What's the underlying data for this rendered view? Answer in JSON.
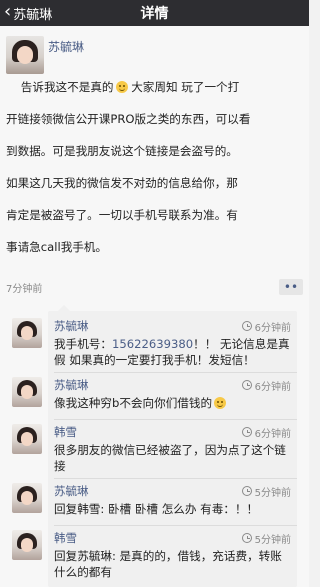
{
  "nav": {
    "back_label": "苏毓琳",
    "title": "详情"
  },
  "post": {
    "author": "苏毓琳",
    "text_lines": [
      "告诉我这不是真的",
      " 大家周知 玩了一个打",
      "开链接领微信公开课PRO版之类的东西，可以看",
      "到数据。可是我朋友说这个链接是会盗号的。",
      "如果这几天我的微信发不对劲的信息给你，那",
      "肯定是被盗号了。一切以手机号联系为准。有",
      "事请急call我手机。"
    ],
    "time": "7分钟前"
  },
  "comments": [
    {
      "name": "苏毓琳",
      "time": "6分钟前",
      "text_prefix": "我手机号：",
      "phone": "15622639380",
      "text_suffix": "！！ 无论信息是真假 如果真的一定要打我手机！发短信！"
    },
    {
      "name": "苏毓琳",
      "time": "6分钟前",
      "text": "像我这种穷b不会向你们借钱的"
    },
    {
      "name": "韩雪",
      "time": "6分钟前",
      "text": "很多朋友的微信已经被盗了，因为点了这个链接"
    },
    {
      "name": "苏毓琳",
      "time": "5分钟前",
      "text": "回复韩雪: 卧槽 卧槽 怎么办 有毒：！！"
    },
    {
      "name": "韩雪",
      "time": "5分钟前",
      "text": "回复苏毓琳: 是真的的，借钱，充话费，转账什么的都有"
    }
  ]
}
